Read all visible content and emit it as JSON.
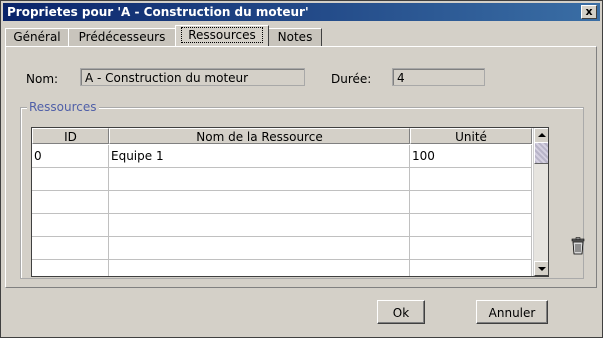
{
  "window": {
    "title": "Proprietes pour 'A - Construction du moteur'",
    "close_label": "x"
  },
  "tabs": [
    {
      "label": "Général",
      "active": false
    },
    {
      "label": "Prédécesseurs",
      "active": false
    },
    {
      "label": "Ressources",
      "active": true
    },
    {
      "label": "Notes",
      "active": false
    }
  ],
  "form": {
    "name_label": "Nom:",
    "name_value": "A - Construction du moteur",
    "duration_label": "Durée:",
    "duration_value": "4"
  },
  "resources": {
    "group_title": "Ressources",
    "columns": [
      "ID",
      "Nom de la Ressource",
      "Unité"
    ],
    "rows": [
      [
        "0",
        "Equipe 1",
        "100"
      ],
      [
        "",
        "",
        ""
      ],
      [
        "",
        "",
        ""
      ],
      [
        "",
        "",
        ""
      ],
      [
        "",
        "",
        ""
      ],
      [
        "",
        "",
        ""
      ]
    ]
  },
  "icons": {
    "trash": "trash-icon",
    "scroll_up": "arrow-up-icon",
    "scroll_down": "arrow-down-icon",
    "close": "close-icon"
  },
  "buttons": {
    "ok_label": "Ok",
    "cancel_label": "Annuler"
  }
}
